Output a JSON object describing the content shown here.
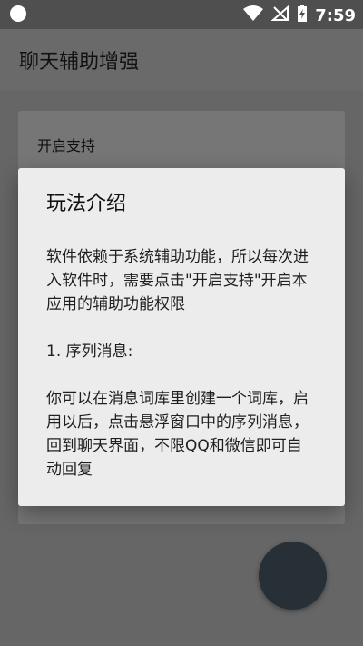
{
  "status_bar": {
    "time": "7:59"
  },
  "app_bar": {
    "title": "聊天辅助增强"
  },
  "main": {
    "top_item_label": "开启支持"
  },
  "dialog": {
    "title": "玩法介绍",
    "paragraphs": [
      "软件依赖于系统辅助功能，所以每次进入软件时，需要点击\"开启支持\"开启本应用的辅助功能权限",
      "1. 序列消息:",
      "你可以在消息词库里创建一个词库，启用以后，点击悬浮窗口中的序列消息，回到聊天界面，不限QQ和微信即可自动回复"
    ]
  },
  "icons": {
    "status_left": "circle-icon",
    "wifi": "wifi-icon",
    "signal_off": "signal-off-icon",
    "battery": "battery-charging-icon"
  }
}
